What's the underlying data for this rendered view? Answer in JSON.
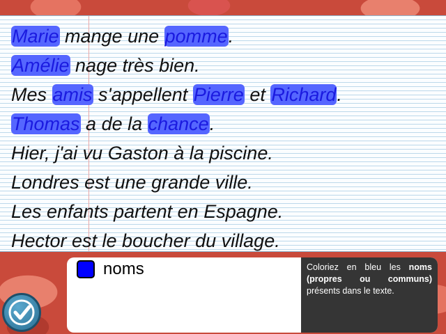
{
  "sentences": [
    [
      {
        "t": "Marie",
        "hl": true
      },
      {
        "t": " mange une "
      },
      {
        "t": "pomme",
        "hl": true
      },
      {
        "t": "."
      }
    ],
    [
      {
        "t": "Amélie",
        "hl": true
      },
      {
        "t": " nage très bien."
      }
    ],
    [
      {
        "t": "Mes "
      },
      {
        "t": "amis",
        "hl": true
      },
      {
        "t": " s'appellent "
      },
      {
        "t": "Pierre",
        "hl": true
      },
      {
        "t": " et "
      },
      {
        "t": "Richard",
        "hl": true
      },
      {
        "t": "."
      }
    ],
    [
      {
        "t": "Thomas",
        "hl": true
      },
      {
        "t": " a de la "
      },
      {
        "t": "chance",
        "hl": true
      },
      {
        "t": "."
      }
    ],
    [
      {
        "t": "Hier, j'ai vu Gaston à la piscine."
      }
    ],
    [
      {
        "t": "Londres est une grande ville."
      }
    ],
    [
      {
        "t": "Les enfants partent en Espagne."
      }
    ],
    [
      {
        "t": "Hector est le boucher du village."
      }
    ]
  ],
  "legend": {
    "label": "noms",
    "color": "#0000ff"
  },
  "instructions": {
    "before": "Coloriez en bleu les ",
    "bold": "noms (propres ou communs)",
    "after": " présents dans le texte."
  },
  "icons": {
    "check_button": "checkmark-icon"
  }
}
